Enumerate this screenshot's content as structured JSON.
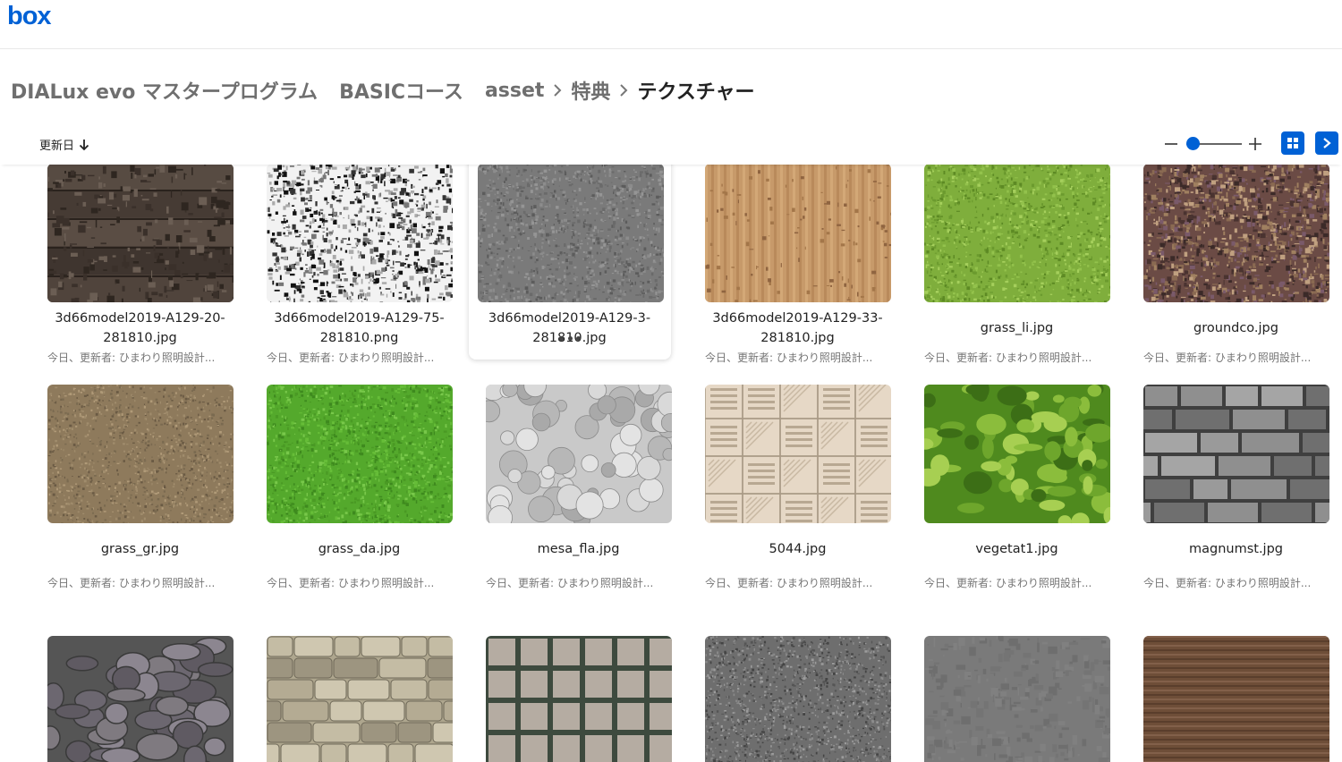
{
  "app": {
    "logo_text": "box",
    "brand_color": "#0061d5"
  },
  "breadcrumb": {
    "items": [
      "DIALux evo マスタープログラム",
      "BASICコース",
      "asset",
      "特典",
      "テクスチャー"
    ]
  },
  "toolbar": {
    "sort_label": "更新日",
    "sort_icon": "arrow-down-icon",
    "zoom_out_icon": "minus-icon",
    "zoom_in_icon": "plus-icon",
    "zoom_level": 0,
    "grid_view_icon": "grid-icon",
    "details_icon": "chevron-right-icon"
  },
  "files": [
    {
      "name_lines": [
        "3d66model2019-A129-20-",
        "281810.jpg"
      ],
      "meta": "今日、更新者: ひまわり照明設計..."
    },
    {
      "name_lines": [
        "3d66model2019-A129-75-",
        "281810.png"
      ],
      "meta": "今日、更新者: ひまわり照明設計..."
    },
    {
      "name_lines": [
        "3d66model2019-A129-3-",
        "281810.jpg"
      ],
      "meta": "",
      "selected": true
    },
    {
      "name_lines": [
        "3d66model2019-A129-33-",
        "281810.jpg"
      ],
      "meta": "今日、更新者: ひまわり照明設計..."
    },
    {
      "name_lines": [
        "grass_li.jpg"
      ],
      "meta": "今日、更新者: ひまわり照明設計..."
    },
    {
      "name_lines": [
        "groundco.jpg"
      ],
      "meta": "今日、更新者: ひまわり照明設計..."
    },
    {
      "name_lines": [
        "grass_gr.jpg"
      ],
      "meta": "今日、更新者: ひまわり照明設計..."
    },
    {
      "name_lines": [
        "grass_da.jpg"
      ],
      "meta": "今日、更新者: ひまわり照明設計..."
    },
    {
      "name_lines": [
        "mesa_fla.jpg"
      ],
      "meta": "今日、更新者: ひまわり照明設計..."
    },
    {
      "name_lines": [
        "5044.jpg"
      ],
      "meta": "今日、更新者: ひまわり照明設計..."
    },
    {
      "name_lines": [
        "vegetat1.jpg"
      ],
      "meta": "今日、更新者: ひまわり照明設計..."
    },
    {
      "name_lines": [
        "magnumst.jpg"
      ],
      "meta": "今日、更新者: ひまわり照明設計..."
    },
    {
      "name_lines": [],
      "meta": ""
    },
    {
      "name_lines": [],
      "meta": ""
    },
    {
      "name_lines": [],
      "meta": ""
    },
    {
      "name_lines": [],
      "meta": ""
    },
    {
      "name_lines": [],
      "meta": ""
    },
    {
      "name_lines": [],
      "meta": ""
    }
  ]
}
